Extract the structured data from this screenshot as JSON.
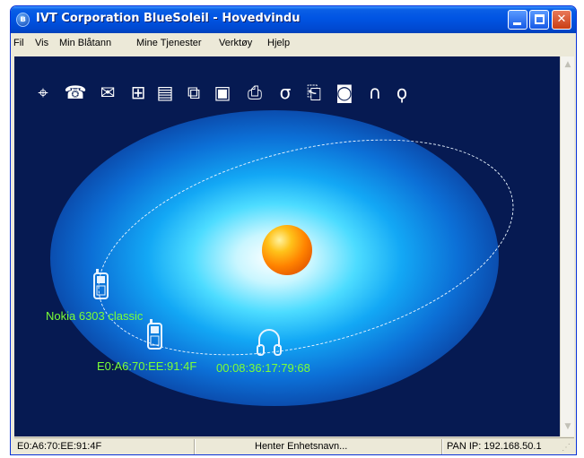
{
  "window": {
    "title": "IVT Corporation BlueSoleil - Hovedvindu",
    "logo_icon": "bluetooth-icon",
    "buttons": {
      "minimize": "minimize-icon",
      "maximize": "maximize-icon",
      "close": "close-icon"
    }
  },
  "menu": {
    "items": [
      {
        "label": "Fil"
      },
      {
        "label": "Vis"
      },
      {
        "label": "Min Blåtann"
      },
      {
        "label": "Mine Tjenester"
      },
      {
        "label": "Verktøy"
      },
      {
        "label": "Hjelp"
      }
    ]
  },
  "services": {
    "icons": [
      {
        "name": "network-access-icon",
        "glyph": "⌖"
      },
      {
        "name": "dialup-networking-icon",
        "glyph": "☎"
      },
      {
        "name": "fax-icon",
        "glyph": "✉"
      },
      {
        "name": "lan-access-icon",
        "glyph": "⊞"
      },
      {
        "name": "file-transfer-icon",
        "glyph": "▤"
      },
      {
        "name": "serial-port-icon",
        "glyph": "⧉"
      },
      {
        "name": "pim-sync-icon",
        "glyph": "▣"
      },
      {
        "name": "printer-icon",
        "glyph": "⎙"
      },
      {
        "name": "mouse-icon",
        "glyph": "σ"
      },
      {
        "name": "object-push-icon",
        "glyph": "⎗"
      },
      {
        "name": "camera-icon",
        "glyph": "◙"
      },
      {
        "name": "headset-icon",
        "glyph": "∩"
      },
      {
        "name": "handsfree-icon",
        "glyph": "ϙ"
      }
    ]
  },
  "devices": [
    {
      "name": "Nokia 6303 classic",
      "icon": "mobile-phone-icon"
    },
    {
      "name": "E0:A6:70:EE:91:4F",
      "icon": "mobile-phone-icon"
    },
    {
      "name": "00:08:36:17:79:68",
      "icon": "headphones-icon"
    }
  ],
  "status": {
    "left": "E0:A6:70:EE:91:4F",
    "center": "Henter Enhetsnavn...",
    "right": "PAN IP: 192.168.50.1"
  },
  "colors": {
    "titlebar": "#0054e3",
    "background": "#061a52",
    "device_label": "#7cff36",
    "orbit": "#e8f4ff"
  }
}
